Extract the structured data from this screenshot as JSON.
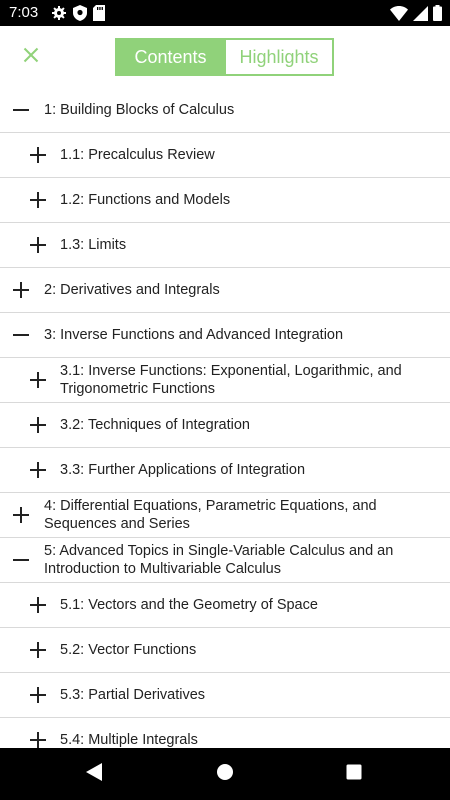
{
  "status_bar": {
    "time": "7:03",
    "left_icons": [
      "gear-icon",
      "shield-icon",
      "sd-card-icon"
    ],
    "right_icons": [
      "wifi-icon",
      "cell-signal-icon",
      "battery-icon"
    ]
  },
  "header": {
    "close_icon": "close-icon",
    "tabs": [
      {
        "label": "Contents",
        "active": true
      },
      {
        "label": "Highlights",
        "active": false
      }
    ]
  },
  "toc": {
    "items": [
      {
        "label": "1: Building Blocks of Calculus",
        "level": 1,
        "expanded": true
      },
      {
        "label": "1.1: Precalculus Review",
        "level": 2,
        "expanded": false
      },
      {
        "label": "1.2: Functions and Models",
        "level": 2,
        "expanded": false
      },
      {
        "label": "1.3: Limits",
        "level": 2,
        "expanded": false
      },
      {
        "label": "2: Derivatives and Integrals",
        "level": 1,
        "expanded": false
      },
      {
        "label": "3: Inverse Functions and Advanced Integration",
        "level": 1,
        "expanded": true
      },
      {
        "label": "3.1: Inverse Functions: Exponential, Logarithmic, and Trigonometric Functions",
        "level": 2,
        "expanded": false
      },
      {
        "label": "3.2: Techniques of Integration",
        "level": 2,
        "expanded": false
      },
      {
        "label": "3.3: Further Applications of Integration",
        "level": 2,
        "expanded": false
      },
      {
        "label": "4: Differential Equations, Parametric Equations, and Sequences and Series",
        "level": 1,
        "expanded": false
      },
      {
        "label": "5: Advanced Topics in Single-Variable Calculus and an Introduction to Multivariable Calculus",
        "level": 1,
        "expanded": true
      },
      {
        "label": "5.1: Vectors and the Geometry of Space",
        "level": 2,
        "expanded": false
      },
      {
        "label": "5.2: Vector Functions",
        "level": 2,
        "expanded": false
      },
      {
        "label": "5.3: Partial Derivatives",
        "level": 2,
        "expanded": false
      },
      {
        "label": "5.4: Multiple Integrals",
        "level": 2,
        "expanded": false
      }
    ]
  },
  "nav_bar": {
    "icons": [
      "back-icon",
      "home-icon",
      "recents-icon"
    ]
  },
  "colors": {
    "accent": "#90d27a",
    "text": "#222222",
    "divider": "#d9d9d9"
  }
}
